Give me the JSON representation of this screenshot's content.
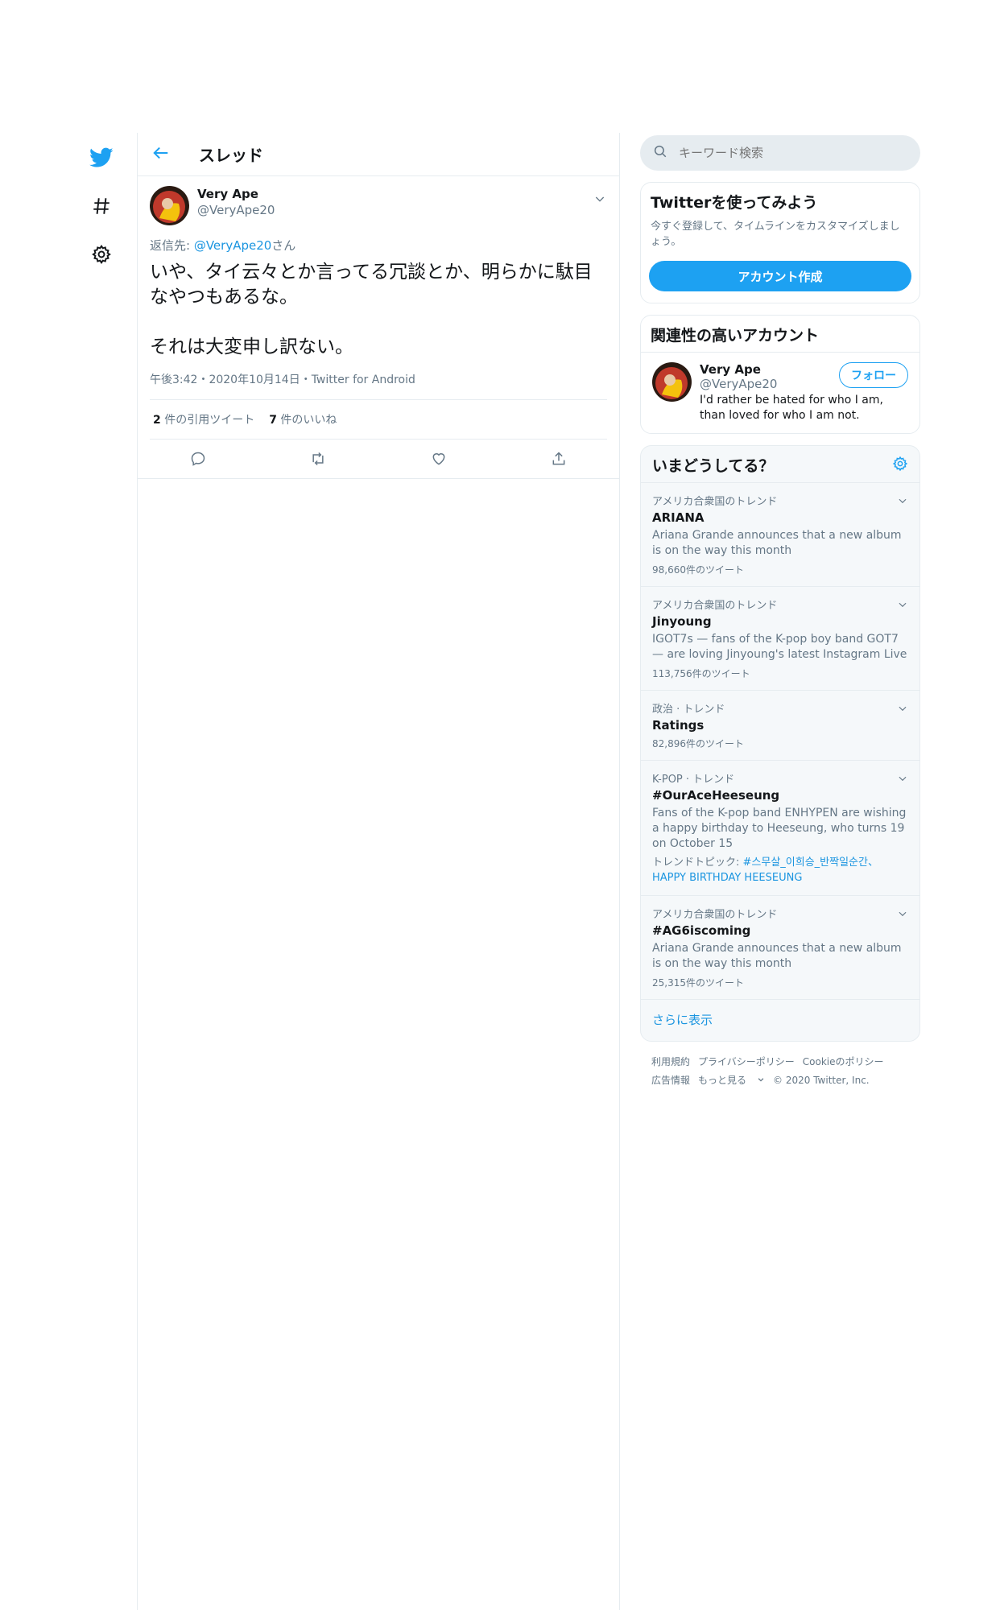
{
  "nav": {
    "icons": [
      "twitter-logo-icon",
      "hashtag-icon",
      "settings-gear-icon"
    ],
    "accent": "#1da1f2"
  },
  "header": {
    "title": "スレッド"
  },
  "tweet": {
    "author_name": "Very Ape",
    "author_handle": "@VeryApe20",
    "reply_prefix": "返信先: ",
    "reply_mention": "@VeryApe20",
    "reply_suffix": "さん",
    "text": "いや、タイ云々とか言ってる冗談とか、明らかに駄目なやつもあるな。\n\nそれは大変申し訳ない。",
    "meta": "午後3:42・2020年10月14日・Twitter for Android",
    "quote_count": "2",
    "quote_label": " 件の引用ツイート",
    "like_count": "7",
    "like_label": " 件のいいね"
  },
  "sidebar": {
    "search_placeholder": "キーワード検索",
    "signup": {
      "title": "Twitterを使ってみよう",
      "desc": "今すぐ登録して、タイムラインをカスタマイズしましょう。",
      "button": "アカウント作成"
    },
    "related": {
      "title": "関連性の高いアカウント",
      "name": "Very Ape",
      "handle": "@VeryApe20",
      "bio": "I'd rather be hated for who I am, than loved for who I am not.",
      "follow": "フォロー"
    },
    "trends": {
      "title": "いまどうしてる？",
      "items": [
        {
          "ctx": "アメリカ合衆国のトレンド",
          "name": "ARIANA",
          "desc": "Ariana Grande announces that a new album is on the way this month",
          "count": "98,660件のツイート"
        },
        {
          "ctx": "アメリカ合衆国のトレンド",
          "name": "Jinyoung",
          "desc": "IGOT7s — fans of the K-pop boy band GOT7 — are loving Jinyoung's latest Instagram Live",
          "count": "113,756件のツイート"
        },
        {
          "ctx": "政治 · トレンド",
          "name": "Ratings",
          "count": "82,896件のツイート"
        },
        {
          "ctx": "K-POP · トレンド",
          "name": "#OurAceHeeseung",
          "desc": "Fans of the K-pop band ENHYPEN are wishing a happy birthday to Heeseung, who turns 19 on October 15",
          "topic_prefix": "トレンドトピック: ",
          "topic_links": "#스무살_이희승_반짝일순간、",
          "topic_links2": "HAPPY BIRTHDAY HEESEUNG"
        },
        {
          "ctx": "アメリカ合衆国のトレンド",
          "name": "#AG6iscoming",
          "desc": "Ariana Grande announces that a new album is on the way this month",
          "count": "25,315件のツイート"
        }
      ],
      "more": "さらに表示"
    },
    "footer": {
      "terms": "利用規約",
      "privacy": "プライバシーポリシー",
      "cookie": "Cookieのポリシー",
      "ads": "広告情報",
      "more": "もっと見る",
      "copyright": "© 2020 Twitter, Inc."
    }
  }
}
